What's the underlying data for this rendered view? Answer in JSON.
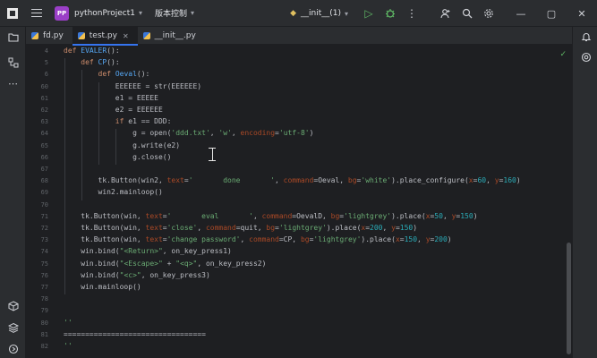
{
  "titlebar": {
    "project_badge": "PP",
    "project_name": "pythonProject1",
    "vcs_label": "版本控制",
    "run_config": "__init__(1)",
    "icons": [
      "app-logo-icon",
      "hamburger-menu-icon",
      "run-icon",
      "debug-icon",
      "more-icon",
      "add-user-icon",
      "search-icon",
      "settings-gear-icon",
      "minimize-icon",
      "maximize-icon",
      "close-icon"
    ]
  },
  "tabs": [
    {
      "label": "fd.py",
      "active": false
    },
    {
      "label": "test.py",
      "active": true
    },
    {
      "label": "__init__.py",
      "active": false
    }
  ],
  "editor": {
    "line_numbers": [
      "4",
      "5",
      "6",
      "60",
      "61",
      "62",
      "63",
      "64",
      "65",
      "66",
      "67",
      "68",
      "69",
      "70",
      "71",
      "72",
      "73",
      "74",
      "75",
      "76",
      "77",
      "78",
      "79",
      "80",
      "81",
      "82"
    ],
    "lines": [
      "def EVALER():",
      "    def CP():",
      "        def Oeval():",
      "            EEEEEE = str(EEEEEE)",
      "            e1 = EEEEE",
      "            e2 = EEEEEE",
      "            if e1 == DDD:",
      "                g = open('ddd.txt', 'w', encoding='utf-8')",
      "                g.write(e2)",
      "                g.close()",
      "",
      "        tk.Button(win2, text='       done       ', command=Oeval, bg='white').place_configure(x=60, y=160)",
      "        win2.mainloop()",
      "",
      "    tk.Button(win, text='       eval       ', command=OevalD, bg='lightgrey').place(x=50, y=150)",
      "    tk.Button(win, text='close', command=quit, bg='lightgrey').place(x=200, y=150)",
      "    tk.Button(win, text='change password', command=CP, bg='lightgrey').place(x=150, y=200)",
      "    win.bind(\"<Return>\", on_key_press1)",
      "    win.bind(\"<Escape>\" + \"<q>\", on_key_press2)",
      "    win.bind(\"<c>\", on_key_press3)",
      "    win.mainloop()",
      "",
      "",
      "'''",
      "=================================",
      "'''"
    ]
  },
  "colors": {
    "background": "#1e1f22",
    "chrome": "#2b2d30",
    "keyword": "#cf8e6d",
    "function": "#56a8f5",
    "string": "#6aab73",
    "param": "#aa4926",
    "number": "#2aacb8",
    "accent": "#3574f0"
  }
}
